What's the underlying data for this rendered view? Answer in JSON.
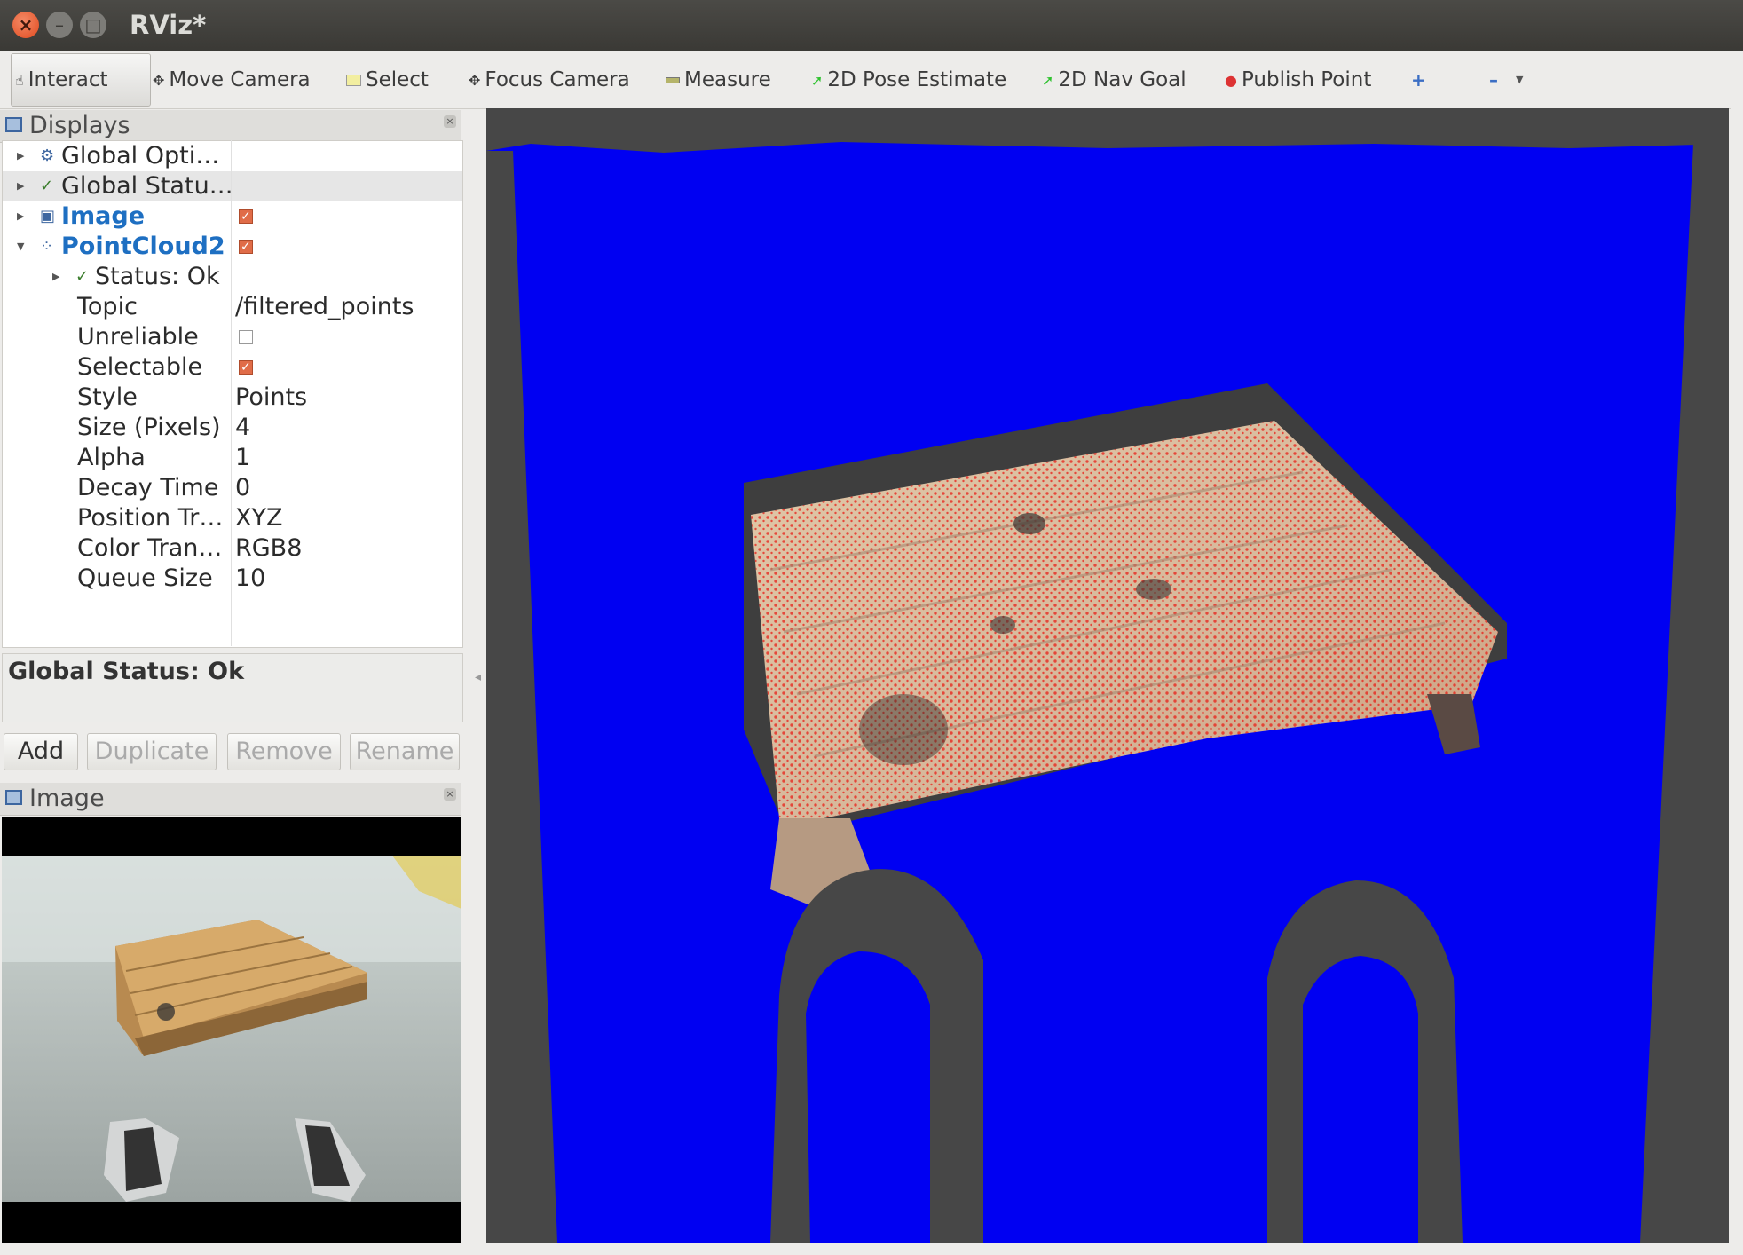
{
  "window": {
    "title": "RViz*"
  },
  "toolbar": {
    "tools": [
      {
        "label": "Interact",
        "icon": "hand-icon",
        "active": true
      },
      {
        "label": "Move Camera",
        "icon": "move-camera-icon"
      },
      {
        "label": "Select",
        "icon": "select-icon"
      },
      {
        "label": "Focus Camera",
        "icon": "focus-camera-icon"
      },
      {
        "label": "Measure",
        "icon": "measure-icon"
      },
      {
        "label": "2D Pose Estimate",
        "icon": "pose-arrow-icon"
      },
      {
        "label": "2D Nav Goal",
        "icon": "goal-arrow-icon"
      },
      {
        "label": "Publish Point",
        "icon": "pin-icon"
      }
    ],
    "extra_icons": [
      "plus-icon",
      "minus-icon",
      "dropdown-icon"
    ]
  },
  "displays": {
    "title": "Displays",
    "items": [
      {
        "label": "Global Opti…",
        "icon": "gear-icon"
      },
      {
        "label": "Global Statu…",
        "icon": "check-icon"
      },
      {
        "label": "Image",
        "icon": "image-icon",
        "checked": true
      },
      {
        "label": "PointCloud2",
        "icon": "pointcloud-icon",
        "checked": true
      }
    ],
    "status_row": "Status: Ok",
    "properties": [
      {
        "label": "Topic",
        "value": "/filtered_points"
      },
      {
        "label": "Unreliable",
        "checkbox": false
      },
      {
        "label": "Selectable",
        "checkbox": true
      },
      {
        "label": "Style",
        "value": "Points"
      },
      {
        "label": "Size (Pixels)",
        "value": "4"
      },
      {
        "label": "Alpha",
        "value": "1"
      },
      {
        "label": "Decay Time",
        "value": "0"
      },
      {
        "label": "Position Tr…",
        "value": "XYZ"
      },
      {
        "label": "Color Tran…",
        "value": "RGB8"
      },
      {
        "label": "Queue Size",
        "value": "10"
      }
    ],
    "global_status": "Global Status: Ok",
    "buttons": {
      "add": "Add",
      "duplicate": "Duplicate",
      "remove": "Remove",
      "rename": "Rename"
    }
  },
  "image_panel": {
    "title": "Image"
  },
  "colors": {
    "floor_blue": "#0000f2",
    "shadow_grey": "#474747",
    "point_red": "#e82018",
    "pallet_wood": "#d9b48a",
    "topic_link_blue": "#1e6fc2"
  }
}
